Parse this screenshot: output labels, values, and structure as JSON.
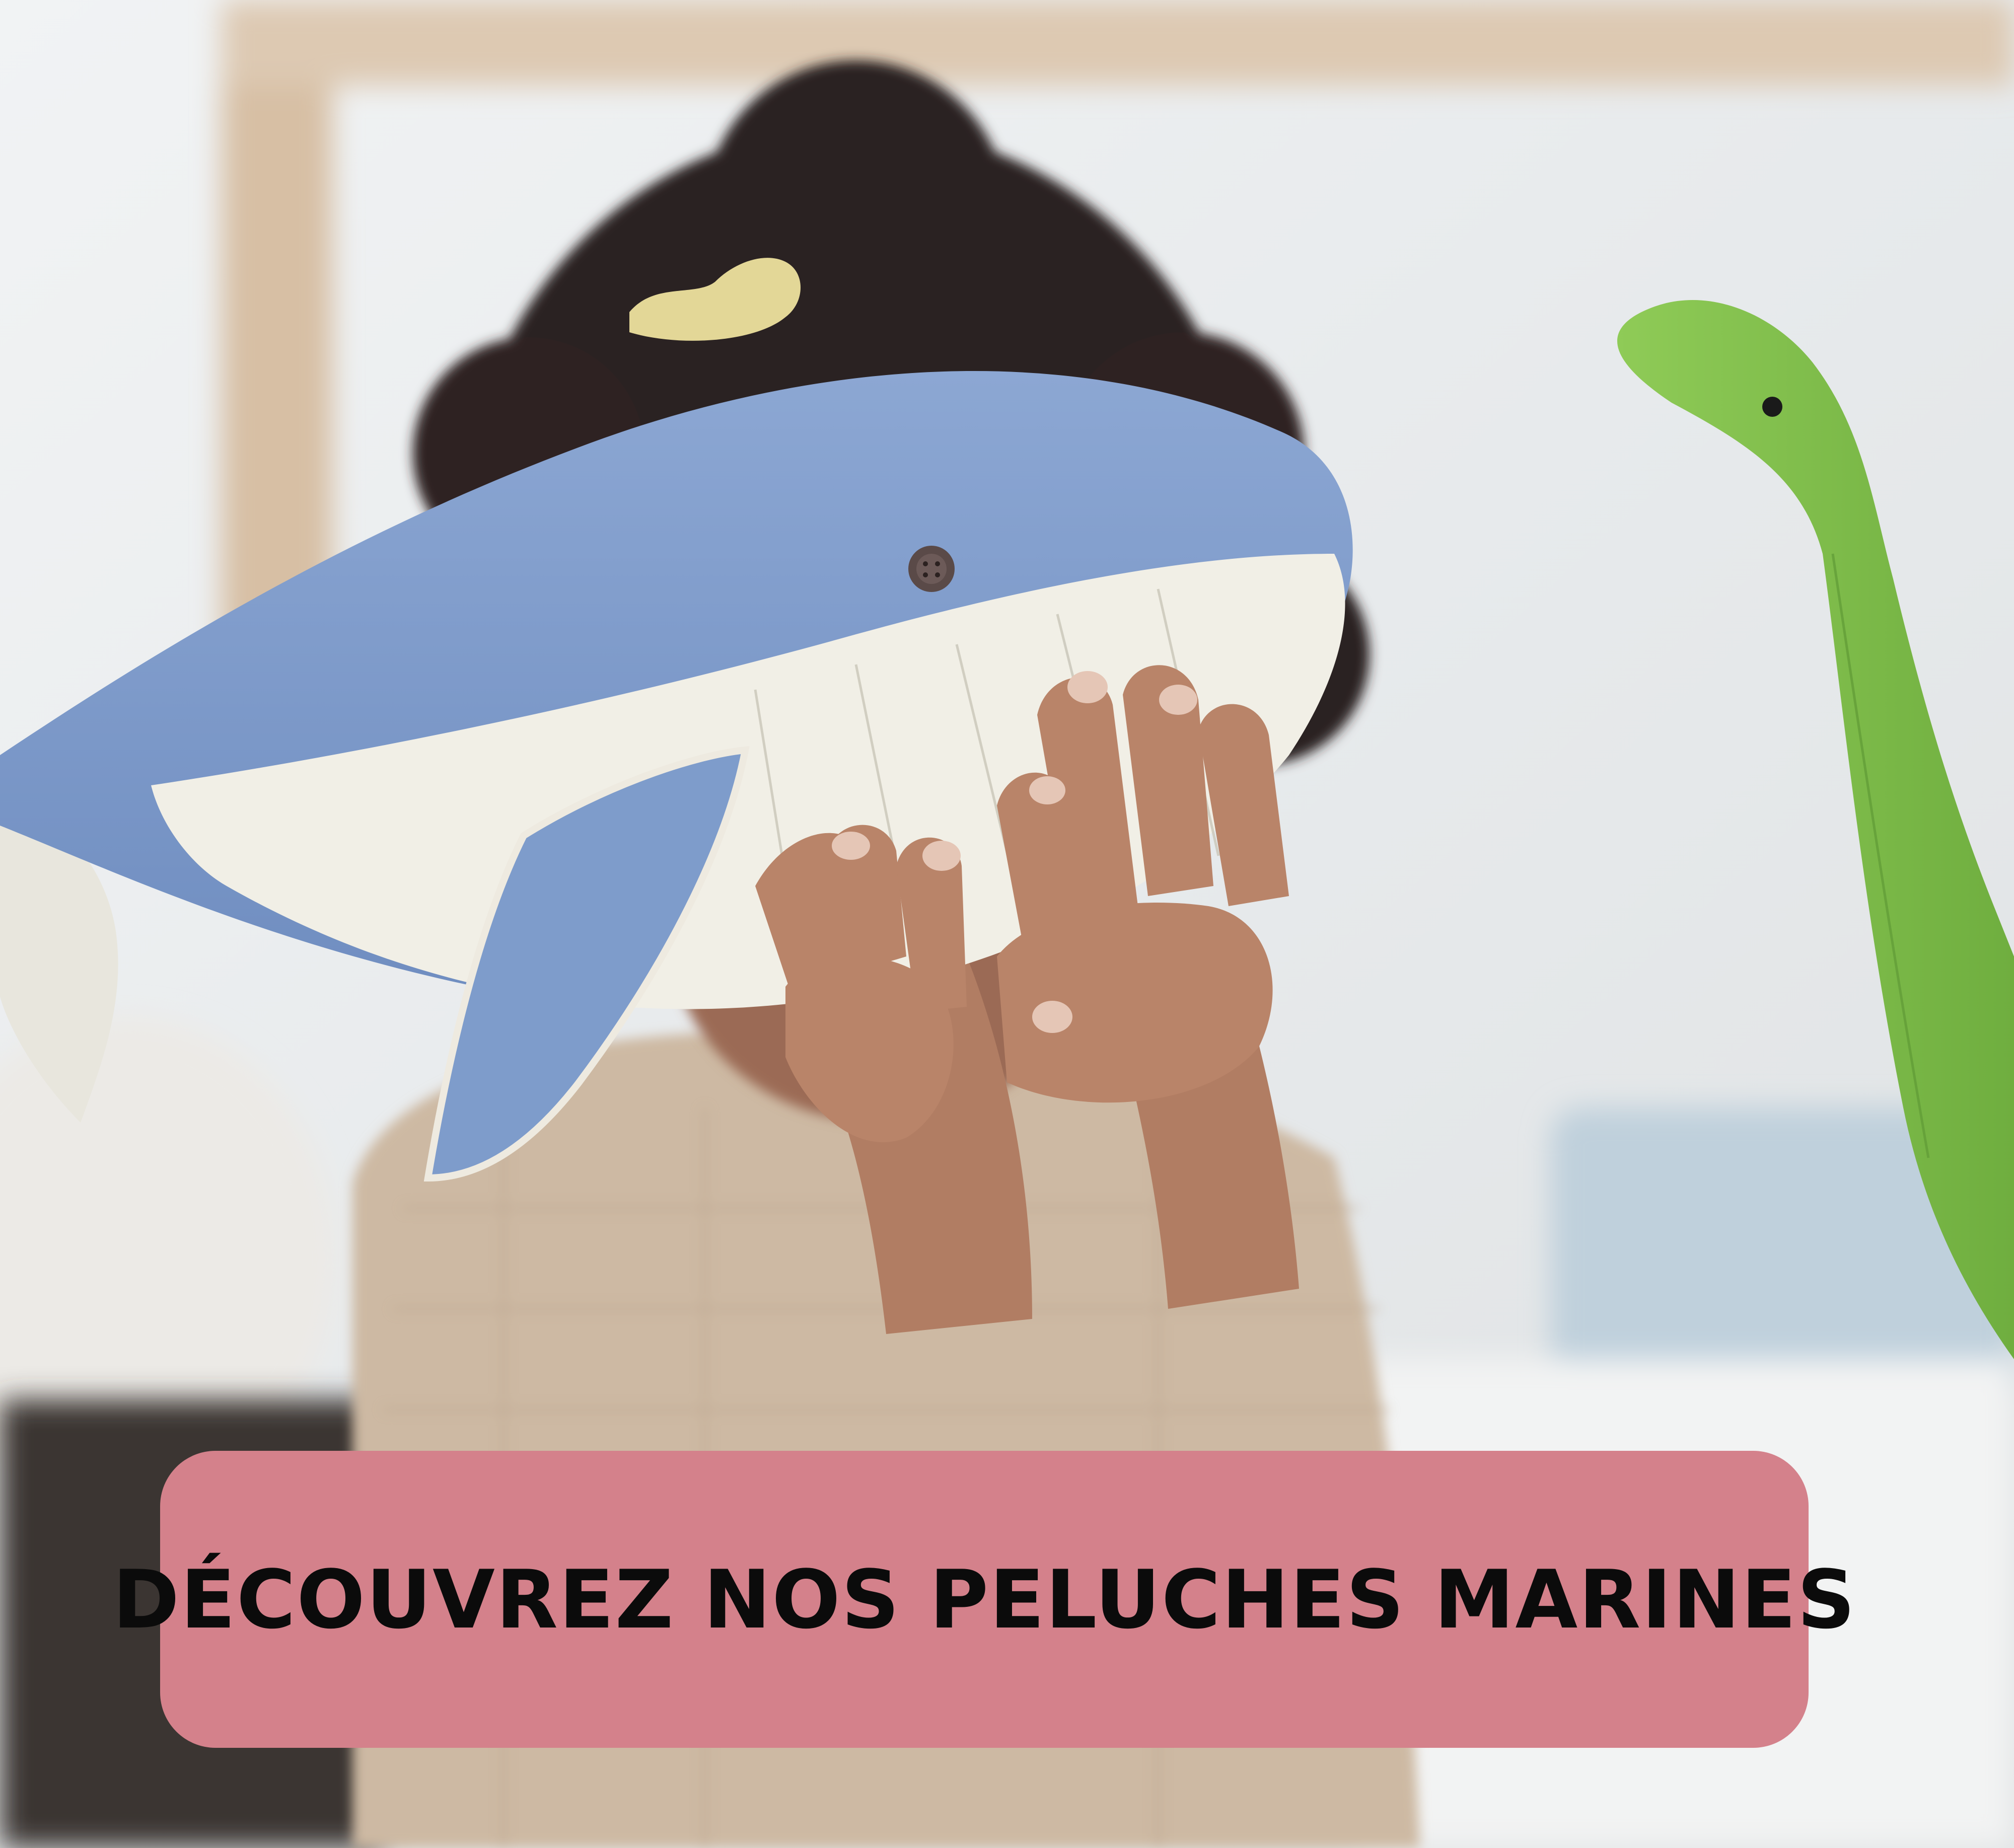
{
  "banner": {
    "cta_label": "DÉCOUVREZ NOS PELUCHES MARINES",
    "cta_color": "#d4818b",
    "text_color": "#0b0b0b"
  },
  "photo": {
    "subjects": [
      "whale-plush",
      "dinosaur-plush",
      "child"
    ],
    "colors": {
      "background": "#e9ecee",
      "whale_blue": "#7e9ccb",
      "whale_belly": "#f1efe6",
      "dino_green": "#7fbf4a",
      "hair": "#2b2120",
      "skin": "#b78367",
      "shirt": "#cdb9a3"
    }
  }
}
